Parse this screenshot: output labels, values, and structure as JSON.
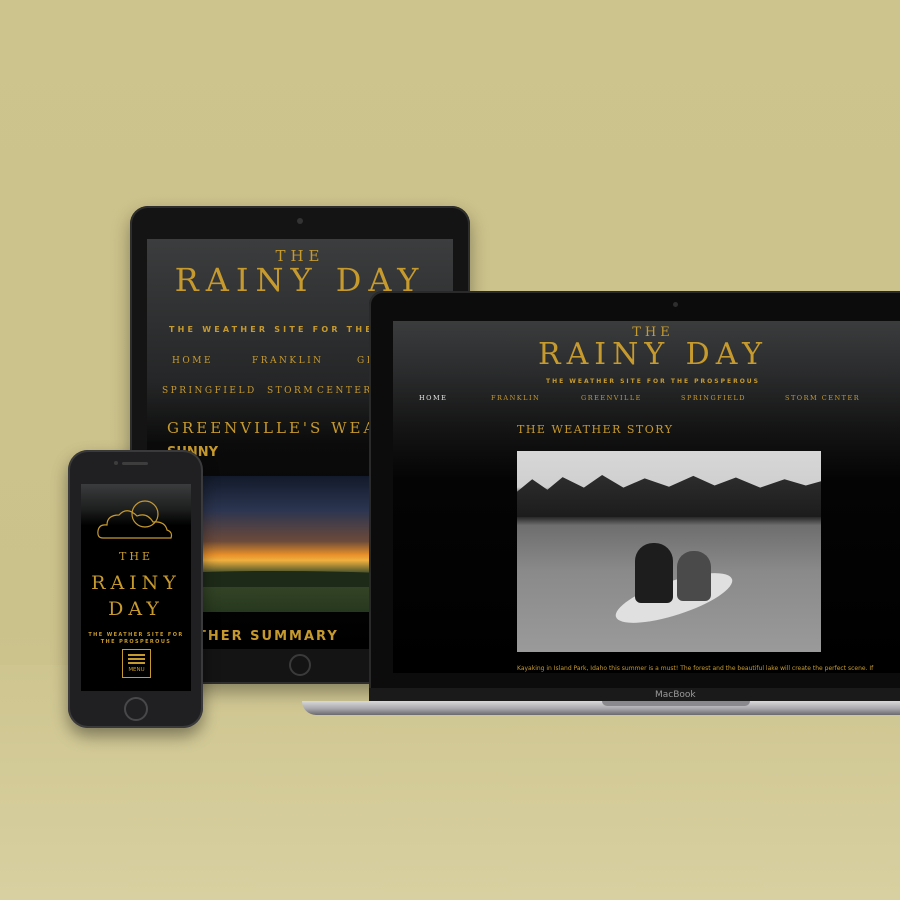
{
  "site": {
    "title_the": "THE",
    "title_main": "RAINY DAY",
    "title_rainy": "RAINY",
    "title_day": "DAY",
    "tagline": "THE WEATHER SITE FOR THE PROSPEROUS",
    "tagline_tablet": "THE WEATHER SITE FOR THE PROS",
    "brand_color": "#c79a2e"
  },
  "tablet": {
    "nav": [
      "HOME",
      "FRANKLIN",
      "GR",
      "SPRINGFIELD",
      "STORM",
      "CENTER"
    ],
    "heading": "GREENVILLE'S WEATHE",
    "condition": "SUNNY",
    "summary_heading": "THER SUMMARY"
  },
  "laptop": {
    "nav": [
      "HOME",
      "FRANKLIN",
      "GREENVILLE",
      "SPRINGFIELD",
      "STORM CENTER"
    ],
    "active_nav": "HOME",
    "section_title": "THE WEATHER STORY",
    "caption": "Kayaking in Island Park, Idaho this summer is a must! The forest and the beautiful lake will create the perfect scene. If",
    "device_label": "MacBook"
  },
  "phone": {
    "menu_label": "MENU",
    "icon": "cloud-sun-icon"
  }
}
